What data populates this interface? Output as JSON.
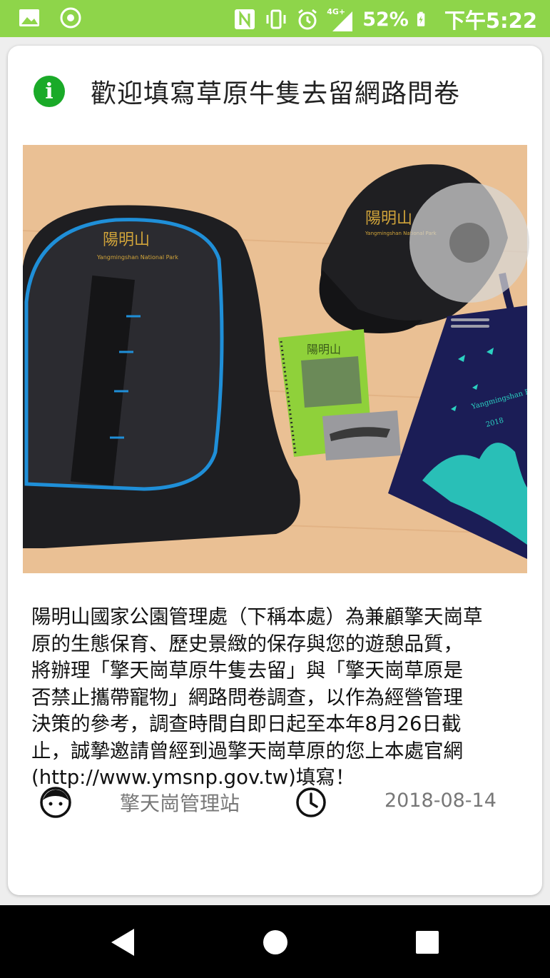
{
  "status_bar": {
    "battery": "52%",
    "network": "4G+",
    "time": "下午5:22",
    "icons": [
      "image-icon",
      "circle-record-icon",
      "nfc-icon",
      "vibrate-icon",
      "alarm-icon",
      "signal-icon",
      "battery-charging-icon"
    ]
  },
  "card": {
    "title": "歡迎填寫草原牛隻去留網路問卷",
    "header_icon": "info-icon",
    "body": "陽明山國家公園管理處（下稱本處）為兼顧擎天崗草\n原的生態保育、歷史景緻的保存與您的遊憩品質，\n將辦理「擎天崗草原牛隻去留」與「擎天崗草原是\n否禁止攜帶寵物」網路問卷調查，以作為經營管理\n決策的參考，調查時間自即日起至本年8月26日截\n止，誠摯邀請曾經到過擎天崗草原的您上本處官網\n(http://www.ymsnp.gov.tw)填寫！",
    "author": "擎天崗管理站",
    "date": "2018-08-14",
    "photo_labels": {
      "backpack": "陽明山",
      "backpack_sub": "Yangmingshan National Park",
      "cap": "陽明山",
      "cap_sub": "Yangmingshan National Park",
      "notebook": "陽明山",
      "bag": "Yangmingshan Butterfly Festival",
      "bag_year": "2018"
    }
  },
  "colors": {
    "status_bar": "#8ed54a",
    "info_icon": "#1aaa28",
    "nav_bar": "#000000"
  },
  "nav": {
    "back": "back-icon",
    "home": "home-icon",
    "recents": "recents-icon"
  }
}
